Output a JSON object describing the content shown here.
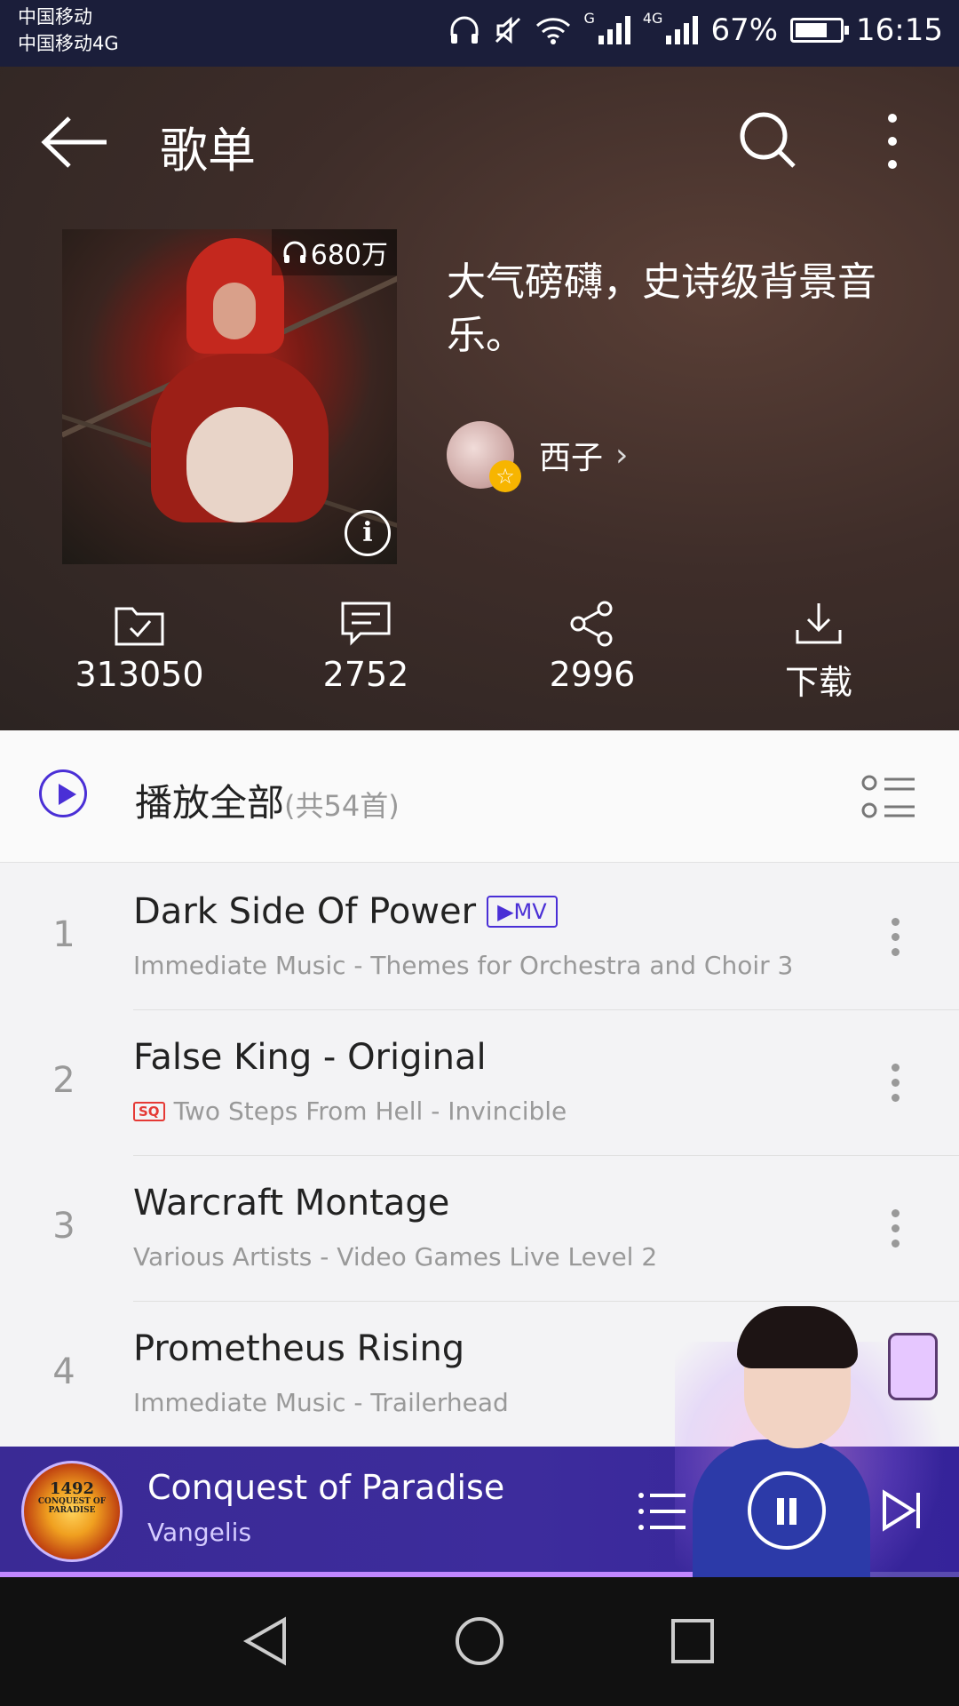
{
  "status_bar": {
    "carrier1": "中国移动",
    "carrier2": "中国移动4G",
    "net1": "G",
    "net2": "4G",
    "battery": "67%",
    "battery_level": 0.67,
    "time": "16:15"
  },
  "header": {
    "title": "歌单"
  },
  "playlist": {
    "play_count": "680万",
    "title": "大气磅礴，史诗级背景音乐。",
    "creator": "西子",
    "creator_arrow": "›",
    "vip_icon": "star-badge-icon"
  },
  "actions": {
    "favorite_count": "313050",
    "comment_count": "2752",
    "share_count": "2996",
    "download_label": "下载"
  },
  "play_all": {
    "label": "播放全部",
    "count": "(共54首)"
  },
  "songs": [
    {
      "index": "1",
      "title": "Dark Side Of Power",
      "badge": "▶MV",
      "subtitle": "Immediate Music - Themes for Orchestra and Choir 3"
    },
    {
      "index": "2",
      "title": "False King - Original",
      "badge": "SQ",
      "subtitle": "Two Steps From Hell - Invincible"
    },
    {
      "index": "3",
      "title": "Warcraft Montage",
      "subtitle": "Various Artists - Video Games Live Level 2"
    },
    {
      "index": "4",
      "title": "Prometheus Rising",
      "subtitle": "Immediate Music - Trailerhead"
    }
  ],
  "now_playing": {
    "title": "Conquest of Paradise",
    "artist": "Vangelis",
    "cover_year": "1492",
    "cover_text": "CONQUEST OF PARADISE",
    "progress": 0.75
  },
  "colors": {
    "accent": "#4a2fd6",
    "player_bg": "#3a2a95",
    "progress": "#c187ff",
    "sq_red": "#e53935"
  }
}
